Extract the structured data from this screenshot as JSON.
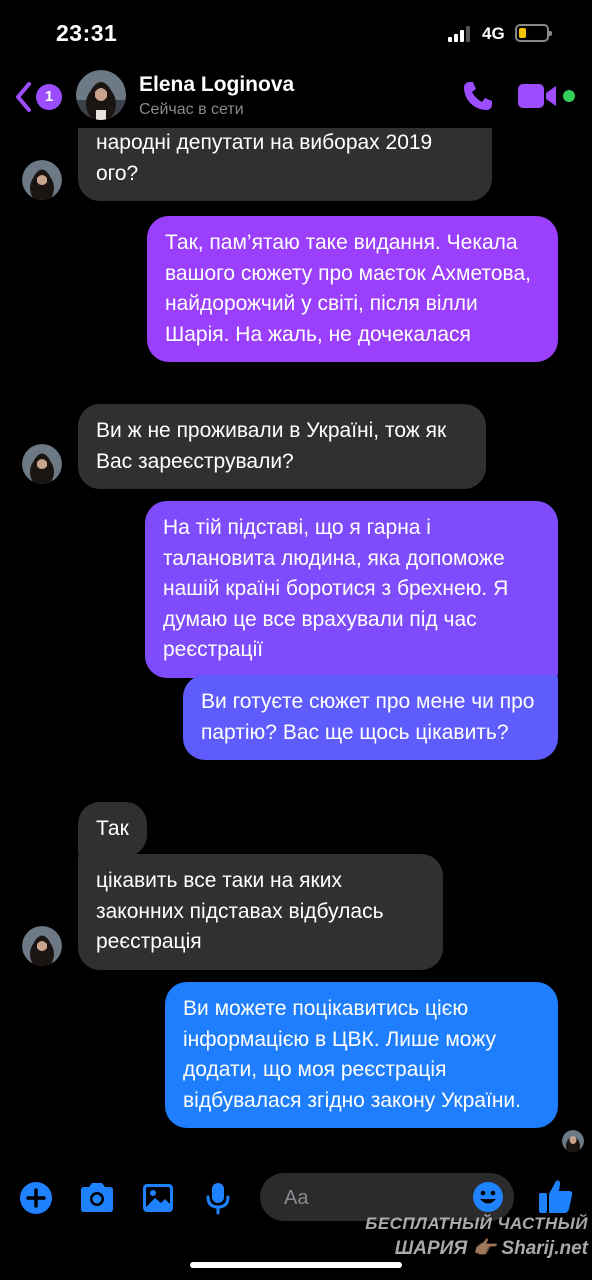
{
  "status_bar": {
    "time": "23:31",
    "network": "4G",
    "battery_level": 0.25
  },
  "header": {
    "back_badge_count": "1",
    "contact_name": "Elena Loginova",
    "contact_status": "Сейчас в сети"
  },
  "messages": [
    {
      "direction": "incoming",
      "text": "народні депутати на виборах 2019 ого?"
    },
    {
      "direction": "outgoing",
      "text": "Так, пам’ятаю таке видання. Чекала вашого сюжету про маєток Ахметова, найдорожчий у світі, після вілли Шарія. На жаль, не дочекалася"
    },
    {
      "direction": "incoming",
      "text": "Ви ж не проживали в Україні, тож як Вас зареєстрували?"
    },
    {
      "direction": "outgoing",
      "text": "На тій підставі, що я гарна і талановита людина, яка допоможе нашій країні боротися з брехнею. Я думаю це все врахували під час реєстрації"
    },
    {
      "direction": "outgoing",
      "text": "Ви готуєте сюжет про мене чи про партію? Вас ще щось цікавить?"
    },
    {
      "direction": "incoming",
      "text": "Так"
    },
    {
      "direction": "incoming",
      "text": "цікавить все таки на яких законних підставах відбулась реєстрація"
    },
    {
      "direction": "outgoing",
      "text": "Ви можете поцікавитись цією інформацією в ЦВК. Лише можу додати, що моя реєстрація відбувалася згідно закону України."
    }
  ],
  "composer": {
    "placeholder": "Aa"
  },
  "watermark": {
    "line1": "БЕСПЛАТНЫЙ ЧАСТНЫЙ",
    "line2": "ШАРИЯ 👉🏽 Sharij.net"
  },
  "colors": {
    "accent_purple": "#9b4dff",
    "composer_blue": "#1e82ff",
    "incoming_bubble": "#303032",
    "online_green": "#31d05b",
    "outgoing_gradient": [
      "#9a3ffb",
      "#7e4cfc",
      "#5f5cfd",
      "#3b6efe",
      "#1e7efe"
    ]
  },
  "icons": [
    "back-chevron-icon",
    "phone-icon",
    "video-camera-icon",
    "plus-icon",
    "camera-icon",
    "gallery-icon",
    "microphone-icon",
    "emoji-icon",
    "thumbs-up-icon"
  ]
}
